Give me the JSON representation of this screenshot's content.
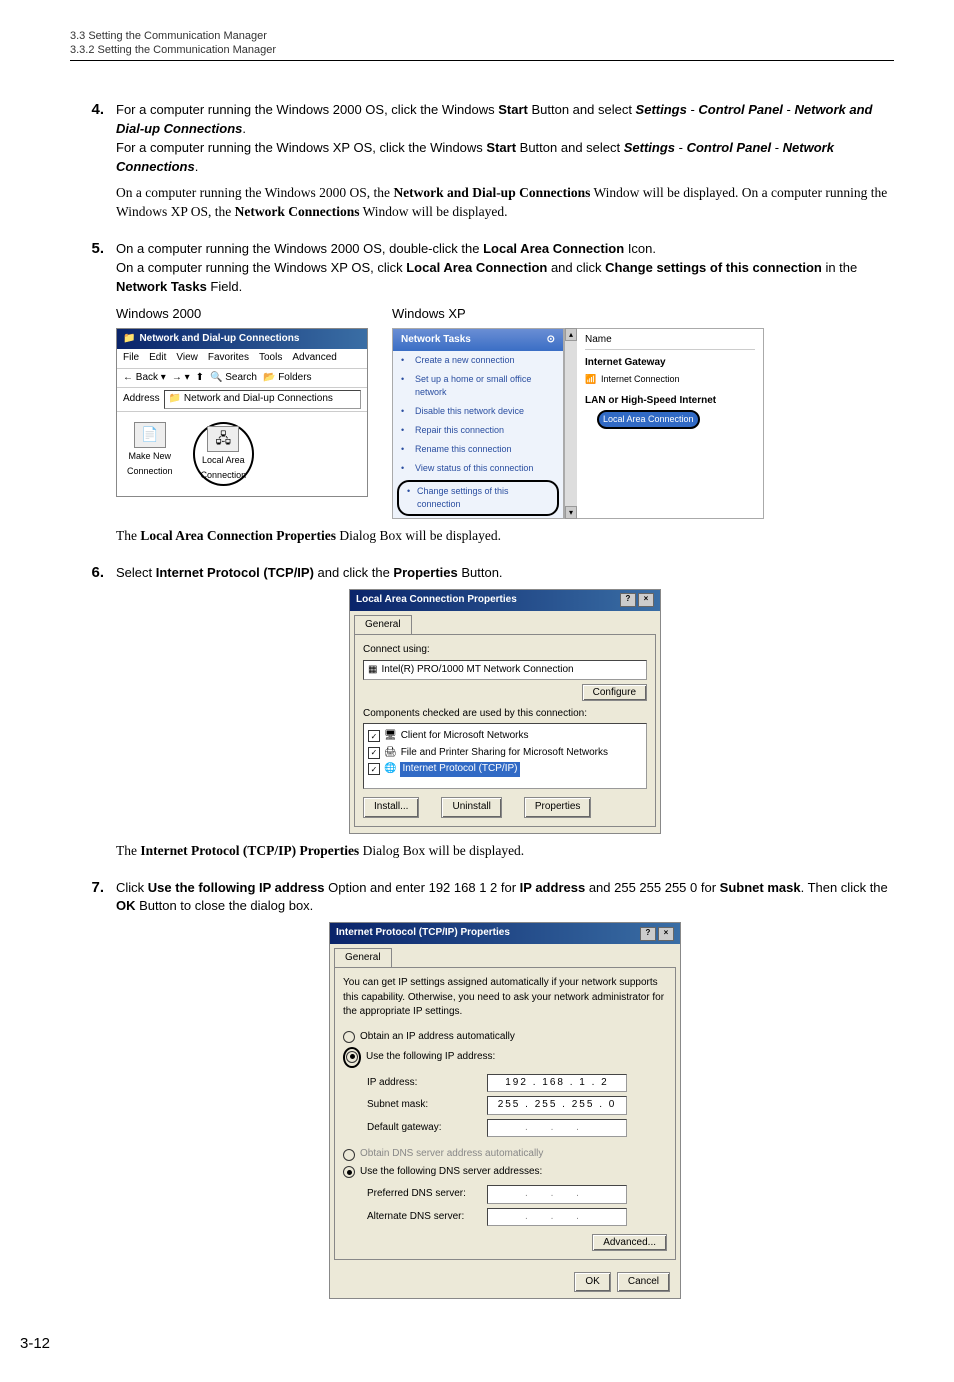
{
  "header": {
    "section": "3.3  Setting the Communication Manager",
    "subsection": "3.3.2  Setting the Communication Manager"
  },
  "steps": {
    "s4": {
      "num": "4.",
      "line1a": "For a computer running the Windows 2000 OS, click the Windows ",
      "line1b": "Start",
      "line1c": " Button and select ",
      "line1d": "Settings",
      "line1e": " - ",
      "line1f": "Control Panel",
      "line1g": " - ",
      "line1h": "Network and Dial-up Connections",
      "line1i": ".",
      "line2a": "For a computer running the Windows XP OS, click the Windows ",
      "line2b": "Start",
      "line2c": " Button and select ",
      "line2d": "Settings",
      "line2e": " - ",
      "line2f": "Control Panel",
      "line2g": " - ",
      "line2h": "Network Connections",
      "line2i": ".",
      "note1a": "On a computer running the Windows 2000 OS, the ",
      "note1b": "Network and Dial-up Connections",
      "note1c": " Window will be displayed. On a computer running the Windows XP OS, the ",
      "note1d": "Network Connections",
      "note1e": " Window will be displayed."
    },
    "s5": {
      "num": "5.",
      "line1a": "On a computer running the Windows 2000 OS, double-click the ",
      "line1b": "Local Area Connection",
      "line1c": " Icon.",
      "line2a": "On a computer running the Windows XP OS, click ",
      "line2b": "Local Area Connection",
      "line2c": " and click ",
      "line2d": "Change settings of this connection",
      "line2e": " in the ",
      "line2f": "Network Tasks",
      "line2g": " Field.",
      "label2000": "Windows 2000",
      "labelxp": "Windows XP",
      "resulta": "The ",
      "resultb": "Local Area Connection Properties",
      "resultc": " Dialog Box will be displayed."
    },
    "s6": {
      "num": "6.",
      "line1a": "Select ",
      "line1b": "Internet Protocol (TCP/IP)",
      "line1c": " and click the ",
      "line1d": "Properties",
      "line1e": " Button.",
      "resulta": "The ",
      "resultb": "Internet Protocol (TCP/IP) Properties",
      "resultc": " Dialog Box will be displayed."
    },
    "s7": {
      "num": "7.",
      "line1a": "Click ",
      "line1b": "Use the following IP address",
      "line1c": " Option and enter 192 168 1 2 for ",
      "line1d": "IP address",
      "line1e": " and 255 255 255 0 for ",
      "line1f": "Subnet mask",
      "line1g": ". Then click the ",
      "line1h": "OK",
      "line1i": " Button to close the dialog box."
    }
  },
  "win2000": {
    "title": "Network and Dial-up Connections",
    "menu": [
      "File",
      "Edit",
      "View",
      "Favorites",
      "Tools",
      "Advanced"
    ],
    "back": "Back",
    "search": "Search",
    "folders": "Folders",
    "address_label": "Address",
    "address_value": "Network and Dial-up Connections",
    "icon1_line1": "Make New",
    "icon1_line2": "Connection",
    "icon2_line1": "Local Area",
    "icon2_line2": "Connection"
  },
  "winxp": {
    "tasks_header": "Network Tasks",
    "tasks": [
      "Create a new connection",
      "Set up a home or small office network",
      "Disable this network device",
      "Repair this connection",
      "Rename this connection",
      "View status of this connection",
      "Change settings of this connection"
    ],
    "name_col": "Name",
    "gateway_header": "Internet Gateway",
    "gateway_item": "Internet Connection",
    "lan_header": "LAN or High-Speed Internet",
    "lan_item": "Local Area Connection"
  },
  "lacp": {
    "title": "Local Area Connection Properties",
    "tab": "General",
    "connect_using": "Connect using:",
    "adapter": "Intel(R) PRO/1000 MT Network Connection",
    "configure": "Configure",
    "components_label": "Components checked are used by this connection:",
    "comp1": "Client for Microsoft Networks",
    "comp2": "File and Printer Sharing for Microsoft Networks",
    "comp3": "Internet Protocol (TCP/IP)",
    "install": "Install...",
    "uninstall": "Uninstall",
    "properties": "Properties"
  },
  "ipdialog": {
    "title": "Internet Protocol (TCP/IP) Properties",
    "tab": "General",
    "desc": "You can get IP settings assigned automatically if your network supports this capability. Otherwise, you need to ask your network administrator for the appropriate IP settings.",
    "r1": "Obtain an IP address automatically",
    "r2": "Use the following IP address:",
    "ip_label": "IP address:",
    "ip_value": "192 . 168 .   1  .   2",
    "mask_label": "Subnet mask:",
    "mask_value": "255 . 255 . 255 .   0",
    "gateway_label": "Default gateway:",
    "gateway_value": ".   .   .",
    "r3": "Obtain DNS server address automatically",
    "r4": "Use the following DNS server addresses:",
    "dns1_label": "Preferred DNS server:",
    "dns2_label": "Alternate DNS server:",
    "advanced": "Advanced...",
    "ok": "OK",
    "cancel": "Cancel"
  },
  "page_num": "3-12"
}
